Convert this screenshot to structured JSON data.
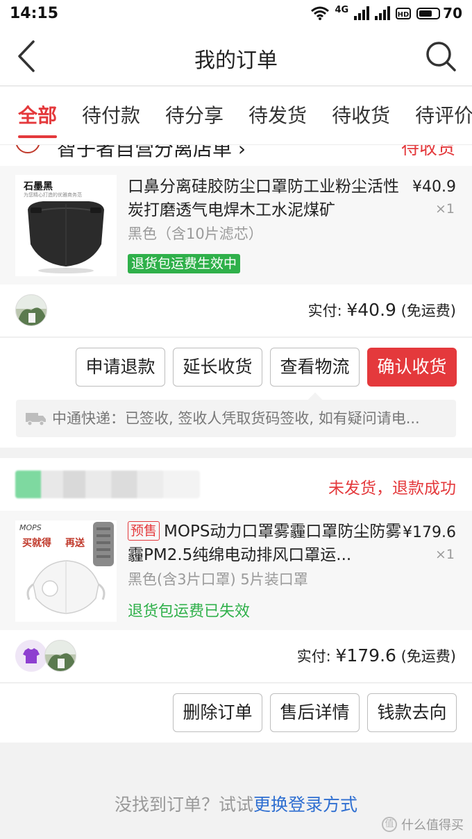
{
  "status_bar": {
    "time": "14:15",
    "network": "4G",
    "battery": "70"
  },
  "nav": {
    "title": "我的订单",
    "back_icon": "chevron-left-icon",
    "search_icon": "search-icon"
  },
  "tabs": [
    {
      "label": "全部",
      "active": true
    },
    {
      "label": "待付款",
      "active": false
    },
    {
      "label": "待分享",
      "active": false
    },
    {
      "label": "待发货",
      "active": false
    },
    {
      "label": "待收货",
      "active": false
    },
    {
      "label": "待评价",
      "active": false
    }
  ],
  "order1": {
    "shop_name_partial": "智子者自营分离店单 ›",
    "status_partial": "待收货",
    "product": {
      "image_brand": "石墨黑",
      "image_caption": "为您精心打造的优雅商务范",
      "title": "口鼻分离硅胶防尘口罩防工业粉尘活性炭打磨透气电焊木工水泥煤矿",
      "spec": "黑色（含10片滤芯）",
      "badge": "退货包运费生效中",
      "price": "¥40.9",
      "qty": "×1"
    },
    "paid": {
      "label": "实付: ",
      "amount": "¥40.9",
      "note": " (免运费)"
    },
    "buttons": [
      "申请退款",
      "延长收货",
      "查看物流",
      "确认收货"
    ],
    "logistics": "中通快递：已签收, 签收人凭取货码签收, 如有疑问请电..."
  },
  "order2": {
    "status": "未发货，退款成功",
    "product": {
      "image_brand": "MOPS",
      "image_promo_1": "买就得",
      "image_promo_2": "再送",
      "presale_tag": "预售",
      "title": "MOPS动力口罩雾霾口罩防尘防雾霾PM2.5纯绵电动排风口罩运...",
      "spec": "黑色(含3片口罩) 5片装口罩",
      "badge": "退货包运费已失效",
      "price": "¥179.6",
      "qty": "×1"
    },
    "paid": {
      "label": "实付: ",
      "amount": "¥179.6",
      "note": " (免运费)"
    },
    "buttons": [
      "删除订单",
      "售后详情",
      "钱款去向"
    ]
  },
  "footer": {
    "text": "没找到订单？试试",
    "link": "更换登录方式"
  },
  "watermark": {
    "icon_text": "值",
    "text": "什么值得买"
  },
  "colors": {
    "accent": "#e4393c",
    "badge_green": "#2fb04a",
    "link_blue": "#2f6fd1"
  }
}
